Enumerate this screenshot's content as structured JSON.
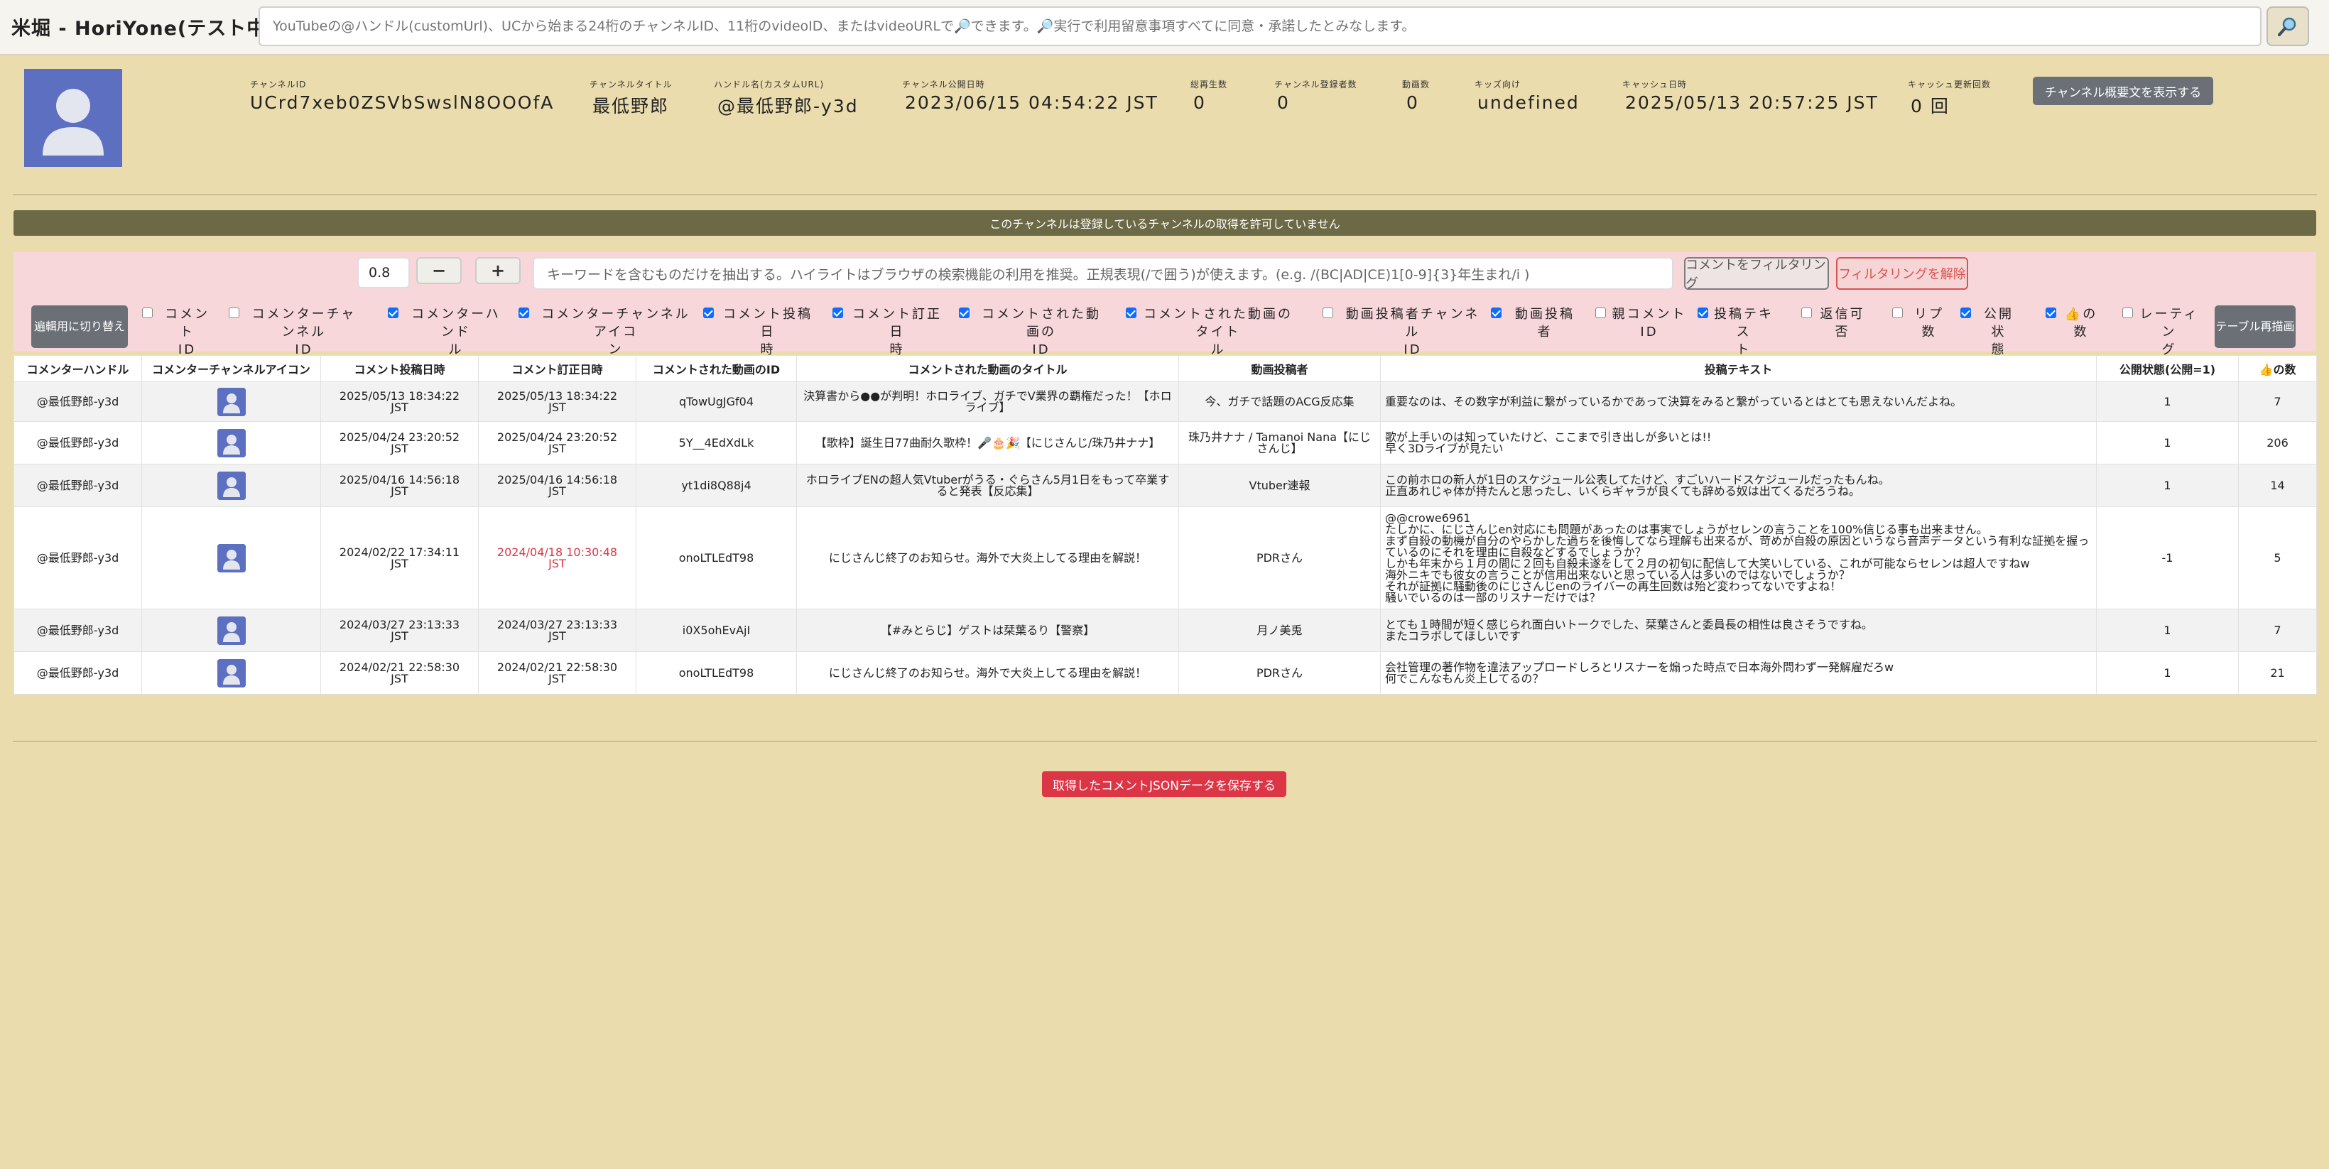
{
  "app": {
    "title": "米堀 - HoriYone(テスト中)",
    "search_placeholder": "YouTubeの@ハンドル(customUrl)、UCから始まる24桁のチャンネルID、11桁のvideoID、またはvideoURLで🔎できます。🔎実行で利用留意事項すべてに同意・承諾したとみなします。"
  },
  "channel": {
    "labels": {
      "id": "チャンネルID",
      "title": "チャンネルタイトル",
      "handle": "ハンドル名(カスタムURL)",
      "published": "チャンネル公開日時",
      "views": "総再生数",
      "subscribers": "チャンネル登録者数",
      "videos": "動画数",
      "kids": "キッズ向け",
      "cache_date": "キャッシュ日時",
      "cache_count": "キャッシュ更新回数"
    },
    "values": {
      "id": "UCrd7xeb0ZSVbSwslN8OOOfA",
      "title": "最低野郎",
      "handle": "@最低野郎-y3d",
      "published": "2023/06/15 04:54:22 JST",
      "views": "0",
      "subscribers": "0",
      "videos": "0",
      "kids": "undefined",
      "cache_date": "2025/05/13 20:57:25 JST",
      "cache_count": "0 回"
    },
    "summary_button": "チャンネル概要文を表示する"
  },
  "notice": "このチャンネルは登録しているチャンネルの取得を許可していません",
  "filter": {
    "zoom": "0.8",
    "minus": "−",
    "plus": "+",
    "placeholder": "キーワードを含むものだけを抽出する。ハイライトはブラウザの検索機能の利用を推奨。正規表現(/で囲う)が使えます。(e.g. /(BC|AD|CE)1[0-9]{3}年生まれ/i )",
    "filter_button": "コメントをフィルタリング",
    "clear_button": "フィルタリングを解除",
    "switch_button": "遍輯用に切り替え",
    "redraw_button": "テーブル再描画"
  },
  "columns_toggle": [
    {
      "label": "コメント\nID",
      "checked": false
    },
    {
      "label": "コメンターチャンネル\nID",
      "checked": false
    },
    {
      "label": "コメンターハンド\nル",
      "checked": true
    },
    {
      "label": "コメンターチャンネルアイコ\nン",
      "checked": true
    },
    {
      "label": "コメント投稿日\n時",
      "checked": true
    },
    {
      "label": "コメント訂正日\n時",
      "checked": true
    },
    {
      "label": "コメントされた動画の\nID",
      "checked": true
    },
    {
      "label": "コメントされた動画のタイト\nル",
      "checked": true
    },
    {
      "label": "動画投稿者チャンネル\nID",
      "checked": false
    },
    {
      "label": "動画投稿\n者",
      "checked": true
    },
    {
      "label": "親コメント\nID",
      "checked": false
    },
    {
      "label": "投稿テキス\nト",
      "checked": true
    },
    {
      "label": "返信可\n否",
      "checked": false
    },
    {
      "label": "リプ\n数",
      "checked": false
    },
    {
      "label": "公開状\n態",
      "checked": true
    },
    {
      "label": "👍の\n数",
      "checked": true
    },
    {
      "label": "レーティン\nグ",
      "checked": false
    }
  ],
  "table": {
    "headers": [
      "コメンターハンドル",
      "コメンターチャンネルアイコン",
      "コメント投稿日時",
      "コメント訂正日時",
      "コメントされた動画のID",
      "コメントされた動画のタイトル",
      "動画投稿者",
      "投稿テキスト",
      "公開状態(公開=1)",
      "👍の数"
    ],
    "rows": [
      {
        "handle": "@最低野郎-y3d",
        "posted": "2025/05/13 18:34:22\nJST",
        "edited": "2025/05/13 18:34:22\nJST",
        "edited_red": false,
        "video_id": "qTowUgJGf04",
        "video_title": "決算書から●●が判明！ホロライブ、ガチでV業界の覇権だった！【ホロライブ】",
        "uploader": "今、ガチで話題のACG反応集",
        "text": "重要なのは、その数字が利益に繋がっているかであって決算をみると繋がっているとはとても思えないんだよね。",
        "public": "1",
        "likes": "7"
      },
      {
        "handle": "@最低野郎-y3d",
        "posted": "2025/04/24 23:20:52\nJST",
        "edited": "2025/04/24 23:20:52\nJST",
        "edited_red": false,
        "video_id": "5Y__4EdXdLk",
        "video_title": "【歌枠】誕生日77曲耐久歌枠！🎤🎂🎉【にじさんじ/珠乃井ナナ】",
        "uploader": "珠乃井ナナ / Tamanoi Nana【にじさんじ】",
        "text": "歌が上手いのは知っていたけど、ここまで引き出しが多いとは!!\n早く3Dライブが見たい",
        "public": "1",
        "likes": "206"
      },
      {
        "handle": "@最低野郎-y3d",
        "posted": "2025/04/16 14:56:18\nJST",
        "edited": "2025/04/16 14:56:18\nJST",
        "edited_red": false,
        "video_id": "yt1di8Q88j4",
        "video_title": "ホロライブENの超人気Vtuberがうる・ぐらさん5月1日をもって卒業すると発表【反応集】",
        "uploader": "Vtuber速報",
        "text": "この前ホロの新人が1日のスケジュール公表してたけど、すごいハードスケジュールだったもんね。\n正直あれじゃ体が持たんと思ったし、いくらギャラが良くても辞める奴は出てくるだろうね。",
        "public": "1",
        "likes": "14"
      },
      {
        "handle": "@最低野郎-y3d",
        "posted": "2024/02/22 17:34:11\nJST",
        "edited": "2024/04/18 10:30:48\nJST",
        "edited_red": true,
        "video_id": "onoLTLEdT98",
        "video_title": "にじさんじ終了のお知らせ。海外で大炎上してる理由を解説！",
        "uploader": "PDRさん",
        "text": "@@crowe6961\nたしかに、にじさんじen対応にも問題があったのは事実でしょうがセレンの言うことを100%信じる事も出来ません。\nまず自殺の動機が自分のやらかした過ちを後悔してなら理解も出来るが、苛めが自殺の原因というなら音声データという有利な証拠を握っているのにそれを理由に自殺などするでしょうか？\nしかも年末から１月の間に２回も自殺未遂をして２月の初旬に配信して大笑いしている、これが可能ならセレンは超人ですねw\n海外ニキでも彼女の言うことが信用出来ないと思っている人は多いのではないでしょうか？\nそれが証拠に騒動後のにじさんじenのライバーの再生回数は殆ど変わってないですよね！\n騒いでいるのは一部のリスナーだけでは？",
        "public": "-1",
        "likes": "5"
      },
      {
        "handle": "@最低野郎-y3d",
        "posted": "2024/03/27 23:13:33\nJST",
        "edited": "2024/03/27 23:13:33\nJST",
        "edited_red": false,
        "video_id": "i0X5ohEvAjI",
        "video_title": "【#みとらじ】ゲストは栞葉るり【警察】",
        "uploader": "月ノ美兎",
        "text": "とても１時間が短く感じられ面白いトークでした、栞葉さんと委員長の相性は良さそうですね。\nまたコラボしてほしいです",
        "public": "1",
        "likes": "7"
      },
      {
        "handle": "@最低野郎-y3d",
        "posted": "2024/02/21 22:58:30\nJST",
        "edited": "2024/02/21 22:58:30\nJST",
        "edited_red": false,
        "video_id": "onoLTLEdT98",
        "video_title": "にじさんじ終了のお知らせ。海外で大炎上してる理由を解説！",
        "uploader": "PDRさん",
        "text": "会社管理の著作物を違法アップロードしろとリスナーを煽った時点で日本海外問わず一発解雇だろw\n何でこんなもん炎上してるの？",
        "public": "1",
        "likes": "21"
      }
    ]
  },
  "save_button": "取得したコメントJSONデータを保存する",
  "colors": {
    "background": "#eadcad",
    "accent_red": "#dc3545",
    "avatar_blue": "#5c6fc0",
    "panel_pink": "#f7d7da",
    "notice_olive": "#6c6946"
  },
  "icons": {
    "search": "magnifier-icon",
    "avatar": "default-user-icon"
  }
}
